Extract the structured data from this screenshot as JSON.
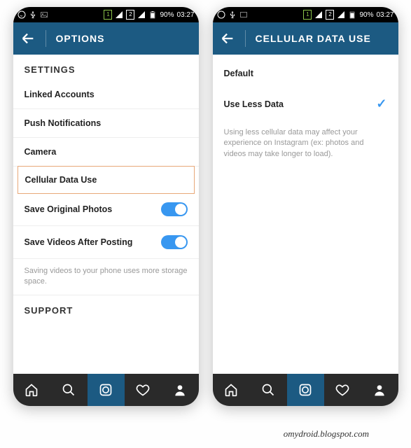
{
  "statusbar": {
    "battery": "90%",
    "time": "03:27"
  },
  "phone1": {
    "appbar_title": "OPTIONS",
    "section_settings": "SETTINGS",
    "rows": {
      "linked": "Linked Accounts",
      "push": "Push Notifications",
      "camera": "Camera",
      "cell": "Cellular Data Use",
      "save_photos": "Save Original Photos",
      "save_videos": "Save Videos After Posting"
    },
    "hint": "Saving videos to your phone uses more storage space.",
    "section_support": "SUPPORT"
  },
  "phone2": {
    "appbar_title": "CELLULAR DATA USE",
    "row_default": "Default",
    "row_less": "Use Less Data",
    "hint": "Using less cellular data may affect your experience on Instagram (ex: photos and videos may take longer to load)."
  },
  "watermark": "omydroid.blogspot.com"
}
